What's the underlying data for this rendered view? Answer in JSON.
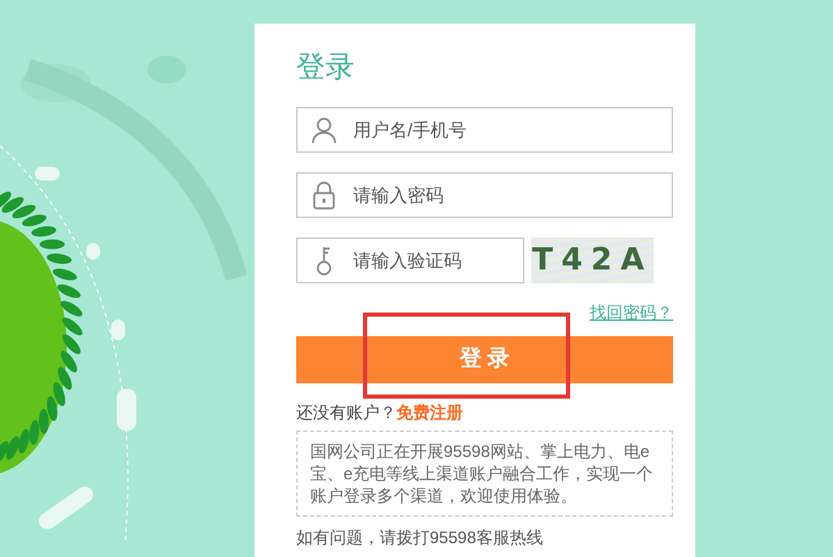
{
  "login_card": {
    "title": "登录",
    "fields": [
      {
        "kind": "username",
        "placeholder": "用户名/手机号"
      },
      {
        "kind": "password",
        "placeholder": "请输入密码"
      },
      {
        "kind": "captcha",
        "placeholder": "请输入验证码",
        "captcha": "T42A"
      }
    ],
    "forgot_link": "找回密码？",
    "submit_button": "登 录",
    "register_prompt": {
      "text": "还没有账户？",
      "link": "免费注册"
    },
    "notice": "国网公司正在开展95598网站、掌上电力、电e宝、e充电等线上渠道账户融合工作，实现一个账户登录多个渠道，欢迎使用体验。",
    "help_text": "如有问题，请拨打95598客服热线"
  }
}
